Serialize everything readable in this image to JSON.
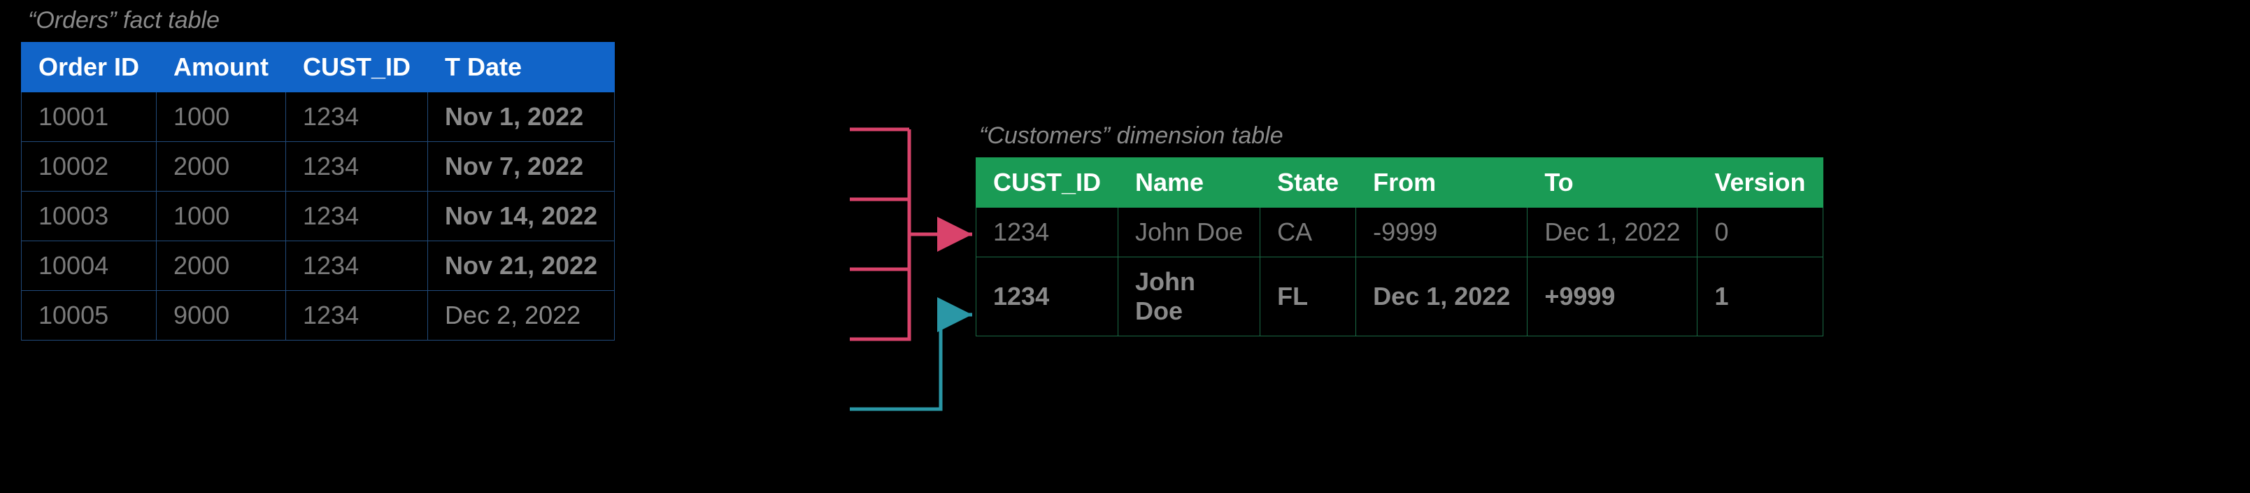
{
  "orders": {
    "caption": "“Orders” fact table",
    "headers": [
      "Order ID",
      "Amount",
      "CUST_ID",
      "T Date"
    ],
    "rows": [
      {
        "id": "10001",
        "amount": "1000",
        "cust": "1234",
        "tdate": "Nov 1, 2022",
        "bold": true
      },
      {
        "id": "10002",
        "amount": "2000",
        "cust": "1234",
        "tdate": "Nov 7, 2022",
        "bold": true
      },
      {
        "id": "10003",
        "amount": "1000",
        "cust": "1234",
        "tdate": "Nov 14, 2022",
        "bold": true
      },
      {
        "id": "10004",
        "amount": "2000",
        "cust": "1234",
        "tdate": "Nov 21, 2022",
        "bold": true
      },
      {
        "id": "10005",
        "amount": "9000",
        "cust": "1234",
        "tdate": "Dec 2, 2022",
        "bold": false
      }
    ]
  },
  "customers": {
    "caption": "“Customers” dimension table",
    "headers": [
      "CUST_ID",
      "Name",
      "State",
      "From",
      "To",
      "Version"
    ],
    "rows": [
      {
        "cust": "1234",
        "name": "John Doe",
        "state": "CA",
        "from": "-9999",
        "to": "Dec 1, 2022",
        "version": "0",
        "bold": false,
        "wrap": false
      },
      {
        "cust": "1234",
        "name": "John Doe",
        "state": "FL",
        "from": "Dec 1, 2022",
        "to": "+9999",
        "version": "1",
        "bold": true,
        "wrap": true
      }
    ]
  },
  "connectors": {
    "red": {
      "targets_rows": [
        0,
        1,
        2,
        3
      ],
      "to_customer_row": 0,
      "color": "#d9436b"
    },
    "teal": {
      "targets_rows": [
        4
      ],
      "to_customer_row": 1,
      "color": "#2a97a6"
    }
  }
}
